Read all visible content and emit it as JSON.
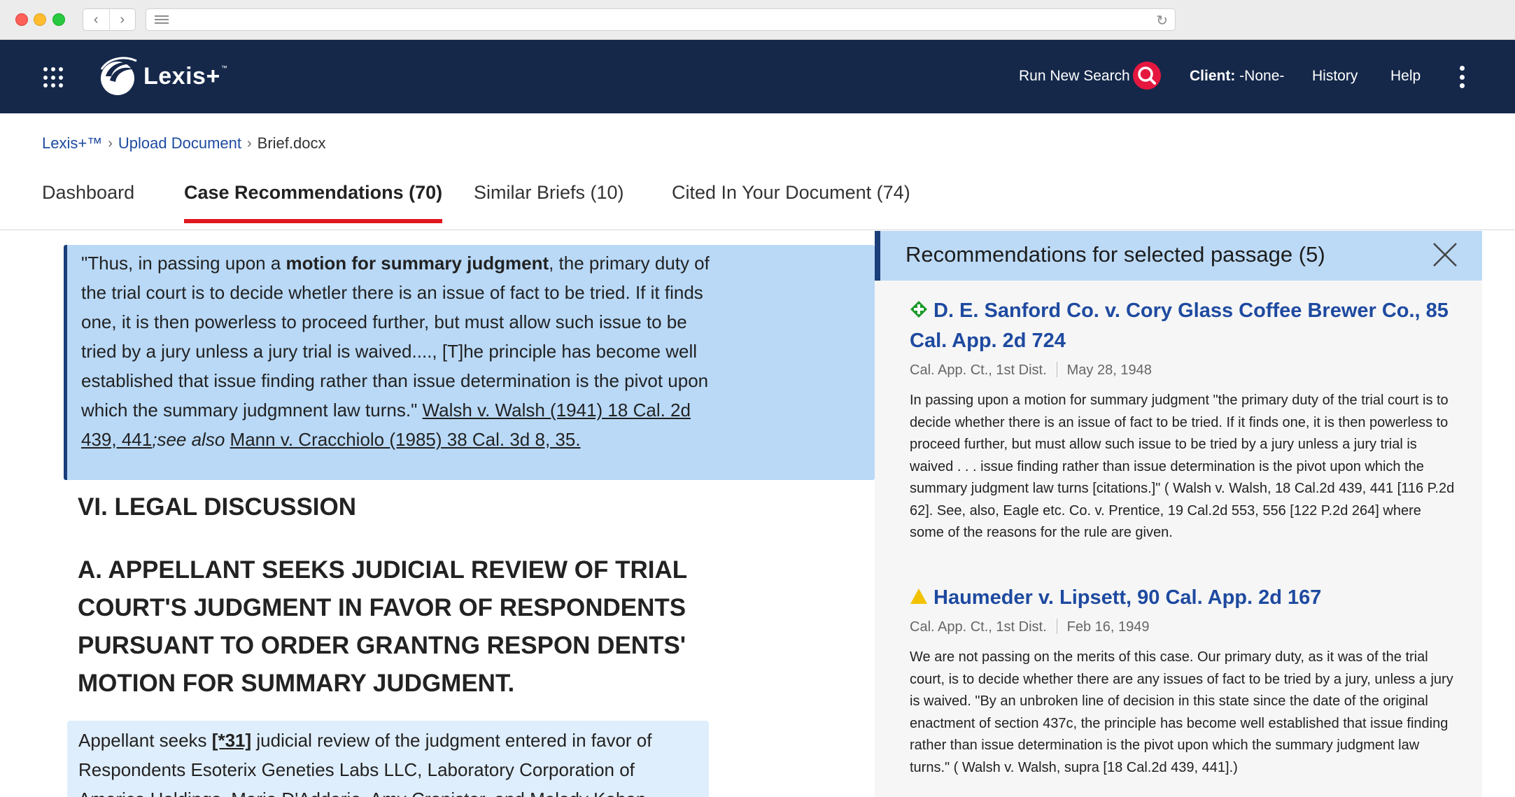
{
  "chrome": {
    "back_icon": "chevron-left-icon",
    "forward_icon": "chevron-right-icon",
    "reader_icon": "reader-icon",
    "reload_icon": "reload-icon"
  },
  "header": {
    "brand": "Lexis+",
    "brand_tm": "™",
    "run_new_search": "Run New Search",
    "client_label": "Client:",
    "client_value": "-None-",
    "history": "History",
    "help": "Help",
    "accent": "#e5173f",
    "bg": "#15284a"
  },
  "breadcrumb": {
    "items": [
      "Lexis+™",
      "Upload Document",
      "Brief.docx"
    ],
    "separator": "›"
  },
  "tabs": [
    {
      "label": "Dashboard",
      "active": false
    },
    {
      "label": "Case Recommendations (70)",
      "active": true
    },
    {
      "label": "Similar Briefs (10)",
      "active": false
    },
    {
      "label": "Cited In Your Document (74)",
      "active": false
    }
  ],
  "document": {
    "quote": {
      "p1": "\"Thus, in passing upon a ",
      "bold": "motion for summary judgment",
      "p2": ", the primary duty of the trial court is to decide whetler there is an issue of fact to be tried. If it finds one, it is then powerless to proceed further, but must allow such issue to be tried by a jury unless a jury trial is waived...., [T]he principle has become well established that issue finding rather than issue determination is the pivot upon which the summary judgmnent law turns.\" ",
      "cite1": "Walsh v. Walsh (1941) 18 Cal. 2d 439, 441",
      "see_also": ";see also",
      "space": " ",
      "cite2": "Mann v. Cracchiolo (1985) 38 Cal. 3d 8, 35."
    },
    "heading_legal": "VI. LEGAL DISCUSSION",
    "heading_appellant": "A. APPELLANT SEEKS JUDICIAL REVIEW OF TRIAL COURT'S JUDGMENT IN FAVOR OF RESPONDENTS PURSUANT TO ORDER GRANTNG RESPON DENTS' MOTION FOR SUMMARY JUDGMENT.",
    "paragraph": {
      "p1": "Appellant seeks ",
      "ref": "[*31]",
      "p2": " judicial review of the judgment entered in favor of Respondents Esoterix Geneties Labs LLC, Laboratory Corporation of America Holdings, Maria D'Addario, Amy Cronister, and Melody Kohan"
    }
  },
  "recommendations": {
    "title": "Recommendations for selected passage (5)",
    "close_icon": "close-icon",
    "cards": [
      {
        "flag_icon": "green-diamond-plus-icon",
        "flag_color": "#1a9a2a",
        "title": "D. E. Sanford Co. v. Cory Glass Coffee Brewer Co., 85 Cal. App. 2d 724",
        "court": "Cal. App. Ct., 1st Dist.",
        "date": "May 28, 1948",
        "snippet": "In passing upon a motion for summary judgment \"the primary duty of the trial court is to decide whether there is an issue of fact to be tried. If it finds one, it is then powerless to proceed further, but must allow such issue to be tried by a jury unless a jury trial is waived . . . issue finding rather than issue determination is the pivot upon which the summary judgment law turns [citations.]\" ( Walsh v. Walsh, 18 Cal.2d 439, 441 [116 P.2d 62]. See, also, Eagle etc. Co. v. Prentice, 19 Cal.2d 553, 556 [122 P.2d 264] where some of the reasons for the rule are given."
      },
      {
        "flag_icon": "yellow-triangle-icon",
        "flag_color": "#f2c200",
        "title": "Haumeder v. Lipsett, 90 Cal. App. 2d 167",
        "court": "Cal. App. Ct., 1st Dist.",
        "date": "Feb 16, 1949",
        "snippet": "We are not passing on the merits of this case. Our primary duty, as it was of the trial court, is to decide whether there are any issues of fact to be tried by a jury, unless a jury is waived. \"By an unbroken line of decision in this state since the date of the original enactment of section 437c, the principle has become well established that issue finding rather than issue determination is the pivot upon which the summary judgment law turns.\" ( Walsh v. Walsh, supra [18 Cal.2d 439, 441].)"
      }
    ]
  }
}
